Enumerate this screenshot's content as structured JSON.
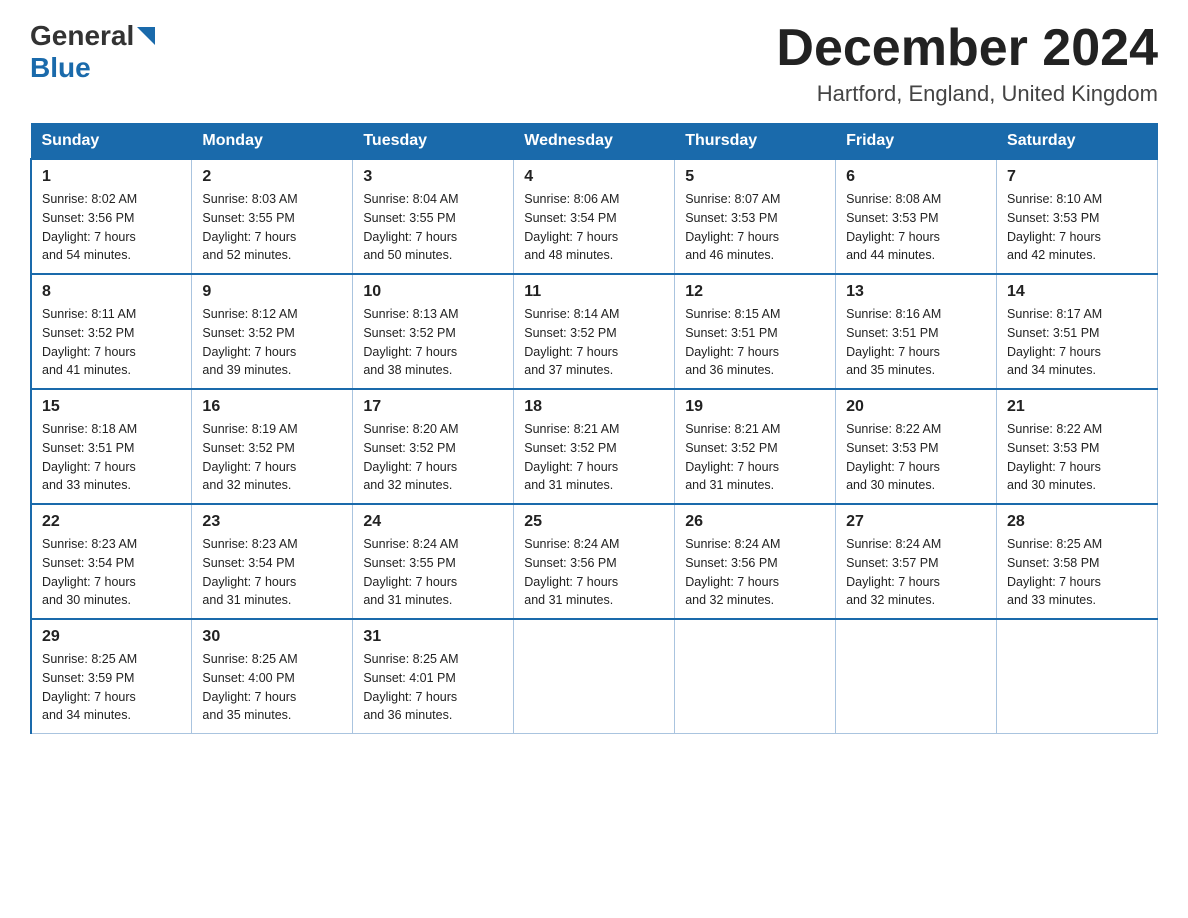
{
  "logo": {
    "general": "General",
    "blue": "Blue"
  },
  "title": "December 2024",
  "subtitle": "Hartford, England, United Kingdom",
  "headers": [
    "Sunday",
    "Monday",
    "Tuesday",
    "Wednesday",
    "Thursday",
    "Friday",
    "Saturday"
  ],
  "weeks": [
    [
      {
        "day": "1",
        "sunrise": "8:02 AM",
        "sunset": "3:56 PM",
        "daylight": "7 hours and 54 minutes."
      },
      {
        "day": "2",
        "sunrise": "8:03 AM",
        "sunset": "3:55 PM",
        "daylight": "7 hours and 52 minutes."
      },
      {
        "day": "3",
        "sunrise": "8:04 AM",
        "sunset": "3:55 PM",
        "daylight": "7 hours and 50 minutes."
      },
      {
        "day": "4",
        "sunrise": "8:06 AM",
        "sunset": "3:54 PM",
        "daylight": "7 hours and 48 minutes."
      },
      {
        "day": "5",
        "sunrise": "8:07 AM",
        "sunset": "3:53 PM",
        "daylight": "7 hours and 46 minutes."
      },
      {
        "day": "6",
        "sunrise": "8:08 AM",
        "sunset": "3:53 PM",
        "daylight": "7 hours and 44 minutes."
      },
      {
        "day": "7",
        "sunrise": "8:10 AM",
        "sunset": "3:53 PM",
        "daylight": "7 hours and 42 minutes."
      }
    ],
    [
      {
        "day": "8",
        "sunrise": "8:11 AM",
        "sunset": "3:52 PM",
        "daylight": "7 hours and 41 minutes."
      },
      {
        "day": "9",
        "sunrise": "8:12 AM",
        "sunset": "3:52 PM",
        "daylight": "7 hours and 39 minutes."
      },
      {
        "day": "10",
        "sunrise": "8:13 AM",
        "sunset": "3:52 PM",
        "daylight": "7 hours and 38 minutes."
      },
      {
        "day": "11",
        "sunrise": "8:14 AM",
        "sunset": "3:52 PM",
        "daylight": "7 hours and 37 minutes."
      },
      {
        "day": "12",
        "sunrise": "8:15 AM",
        "sunset": "3:51 PM",
        "daylight": "7 hours and 36 minutes."
      },
      {
        "day": "13",
        "sunrise": "8:16 AM",
        "sunset": "3:51 PM",
        "daylight": "7 hours and 35 minutes."
      },
      {
        "day": "14",
        "sunrise": "8:17 AM",
        "sunset": "3:51 PM",
        "daylight": "7 hours and 34 minutes."
      }
    ],
    [
      {
        "day": "15",
        "sunrise": "8:18 AM",
        "sunset": "3:51 PM",
        "daylight": "7 hours and 33 minutes."
      },
      {
        "day": "16",
        "sunrise": "8:19 AM",
        "sunset": "3:52 PM",
        "daylight": "7 hours and 32 minutes."
      },
      {
        "day": "17",
        "sunrise": "8:20 AM",
        "sunset": "3:52 PM",
        "daylight": "7 hours and 32 minutes."
      },
      {
        "day": "18",
        "sunrise": "8:21 AM",
        "sunset": "3:52 PM",
        "daylight": "7 hours and 31 minutes."
      },
      {
        "day": "19",
        "sunrise": "8:21 AM",
        "sunset": "3:52 PM",
        "daylight": "7 hours and 31 minutes."
      },
      {
        "day": "20",
        "sunrise": "8:22 AM",
        "sunset": "3:53 PM",
        "daylight": "7 hours and 30 minutes."
      },
      {
        "day": "21",
        "sunrise": "8:22 AM",
        "sunset": "3:53 PM",
        "daylight": "7 hours and 30 minutes."
      }
    ],
    [
      {
        "day": "22",
        "sunrise": "8:23 AM",
        "sunset": "3:54 PM",
        "daylight": "7 hours and 30 minutes."
      },
      {
        "day": "23",
        "sunrise": "8:23 AM",
        "sunset": "3:54 PM",
        "daylight": "7 hours and 31 minutes."
      },
      {
        "day": "24",
        "sunrise": "8:24 AM",
        "sunset": "3:55 PM",
        "daylight": "7 hours and 31 minutes."
      },
      {
        "day": "25",
        "sunrise": "8:24 AM",
        "sunset": "3:56 PM",
        "daylight": "7 hours and 31 minutes."
      },
      {
        "day": "26",
        "sunrise": "8:24 AM",
        "sunset": "3:56 PM",
        "daylight": "7 hours and 32 minutes."
      },
      {
        "day": "27",
        "sunrise": "8:24 AM",
        "sunset": "3:57 PM",
        "daylight": "7 hours and 32 minutes."
      },
      {
        "day": "28",
        "sunrise": "8:25 AM",
        "sunset": "3:58 PM",
        "daylight": "7 hours and 33 minutes."
      }
    ],
    [
      {
        "day": "29",
        "sunrise": "8:25 AM",
        "sunset": "3:59 PM",
        "daylight": "7 hours and 34 minutes."
      },
      {
        "day": "30",
        "sunrise": "8:25 AM",
        "sunset": "4:00 PM",
        "daylight": "7 hours and 35 minutes."
      },
      {
        "day": "31",
        "sunrise": "8:25 AM",
        "sunset": "4:01 PM",
        "daylight": "7 hours and 36 minutes."
      },
      null,
      null,
      null,
      null
    ]
  ],
  "labels": {
    "sunrise": "Sunrise:",
    "sunset": "Sunset:",
    "daylight": "Daylight:"
  }
}
